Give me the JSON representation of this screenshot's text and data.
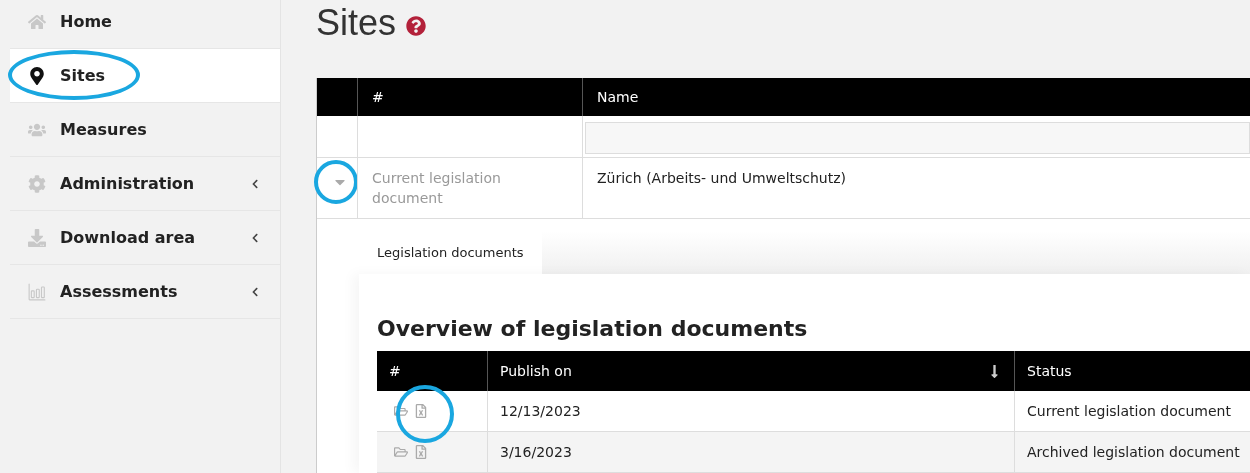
{
  "sidebar": {
    "items": [
      {
        "label": "Home",
        "selected": false,
        "has_submenu": false,
        "highlighted": false
      },
      {
        "label": "Sites",
        "selected": true,
        "has_submenu": false,
        "highlighted": true
      },
      {
        "label": "Measures",
        "selected": false,
        "has_submenu": false,
        "highlighted": false
      },
      {
        "label": "Administration",
        "selected": false,
        "has_submenu": true,
        "highlighted": false
      },
      {
        "label": "Download area",
        "selected": false,
        "has_submenu": true,
        "highlighted": false
      },
      {
        "label": "Assessments",
        "selected": false,
        "has_submenu": true,
        "highlighted": false
      }
    ]
  },
  "page": {
    "title": "Sites"
  },
  "sites_table": {
    "columns": [
      "#",
      "Name"
    ],
    "rows": [
      {
        "number": "Current legislation document",
        "name": "Zürich (Arbeits- und Umweltschutz)",
        "expanded": true,
        "highlighted": true
      }
    ]
  },
  "detail": {
    "tabs": [
      {
        "label": "Legislation documents",
        "selected": true
      }
    ],
    "heading": "Overview of legislation documents",
    "table": {
      "columns": [
        {
          "label": "#",
          "sorted": false
        },
        {
          "label": "Publish on",
          "sorted": true
        },
        {
          "label": "Status",
          "sorted": false
        }
      ],
      "rows": [
        {
          "publish_on": "12/13/2023",
          "status": "Current legislation document",
          "highlighted": true
        },
        {
          "publish_on": "3/16/2023",
          "status": "Archived legislation document",
          "highlighted": false
        }
      ]
    }
  }
}
